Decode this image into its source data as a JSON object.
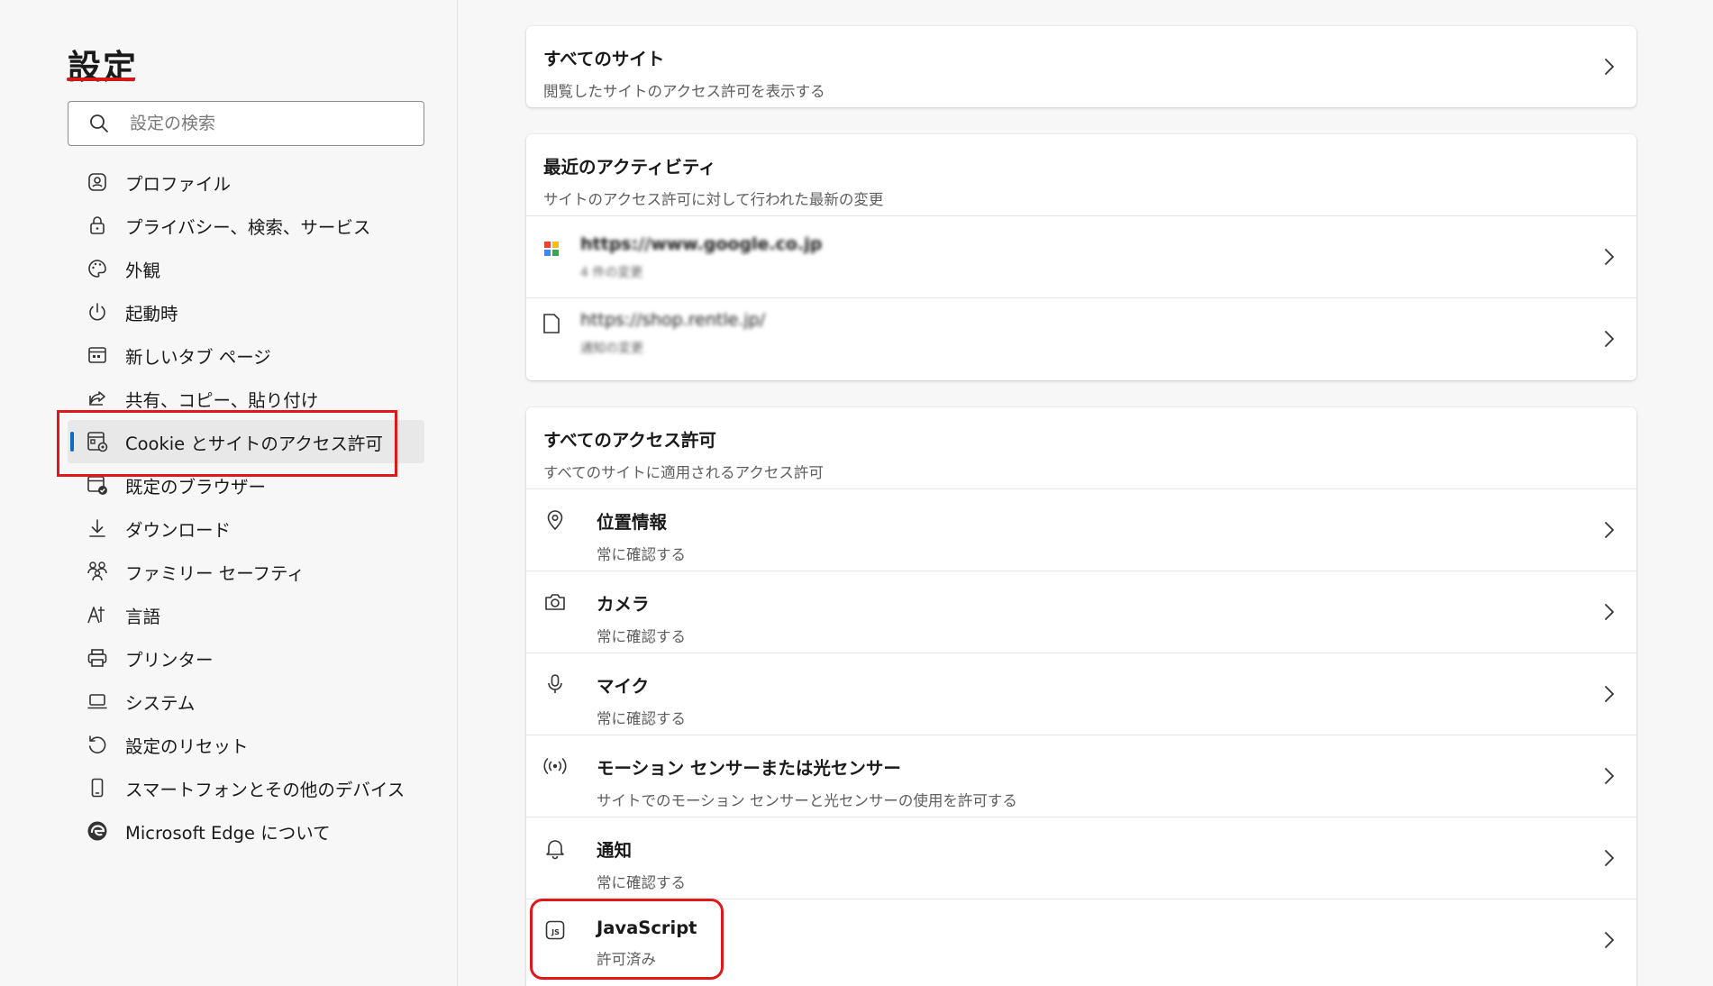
{
  "sidebar": {
    "title": "設定",
    "search": {
      "placeholder": "設定の検索",
      "value": ""
    },
    "items": [
      {
        "label": "プロファイル",
        "icon": "profile-icon"
      },
      {
        "label": "プライバシー、検索、サービス",
        "icon": "lock-icon"
      },
      {
        "label": "外観",
        "icon": "palette-icon"
      },
      {
        "label": "起動時",
        "icon": "power-icon"
      },
      {
        "label": "新しいタブ ページ",
        "icon": "new-tab-icon"
      },
      {
        "label": "共有、コピー、貼り付け",
        "icon": "share-icon"
      },
      {
        "label": "Cookie とサイトのアクセス許可",
        "icon": "cookie-settings-icon",
        "active": true
      },
      {
        "label": "既定のブラウザー",
        "icon": "default-browser-icon"
      },
      {
        "label": "ダウンロード",
        "icon": "download-icon"
      },
      {
        "label": "ファミリー セーフティ",
        "icon": "family-icon"
      },
      {
        "label": "言語",
        "icon": "language-icon"
      },
      {
        "label": "プリンター",
        "icon": "printer-icon"
      },
      {
        "label": "システム",
        "icon": "laptop-icon"
      },
      {
        "label": "設定のリセット",
        "icon": "reset-icon"
      },
      {
        "label": "スマートフォンとその他のデバイス",
        "icon": "phone-icon"
      },
      {
        "label": "Microsoft Edge について",
        "icon": "edge-logo-icon"
      }
    ]
  },
  "main": {
    "all_sites": {
      "title": "すべてのサイト",
      "subtitle": "閲覧したサイトのアクセス許可を表示する"
    },
    "recent_activity": {
      "title": "最近のアクティビティ",
      "subtitle": "サイトのアクセス許可に対して行われた最新の変更",
      "sites": [
        {
          "url": "https://www.google.co.jp",
          "detail": "4 件の変更"
        },
        {
          "url": "https://shop.rentle.jp/",
          "detail": "通知の変更"
        }
      ]
    },
    "all_permissions": {
      "title": "すべてのアクセス許可",
      "subtitle": "すべてのサイトに適用されるアクセス許可",
      "items": [
        {
          "title": "位置情報",
          "subtitle": "常に確認する",
          "icon": "location-icon"
        },
        {
          "title": "カメラ",
          "subtitle": "常に確認する",
          "icon": "camera-icon"
        },
        {
          "title": "マイク",
          "subtitle": "常に確認する",
          "icon": "microphone-icon"
        },
        {
          "title": "モーション センサーまたは光センサー",
          "subtitle": "サイトでのモーション センサーと光センサーの使用を許可する",
          "icon": "sensor-icon"
        },
        {
          "title": "通知",
          "subtitle": "常に確認する",
          "icon": "bell-icon"
        },
        {
          "title": "JavaScript",
          "subtitle": "許可済み",
          "icon": "javascript-icon"
        }
      ]
    }
  },
  "colors": {
    "accent": "#0f6cbd",
    "annotation_red": "#e0171b",
    "background": "#f7f7f7"
  }
}
